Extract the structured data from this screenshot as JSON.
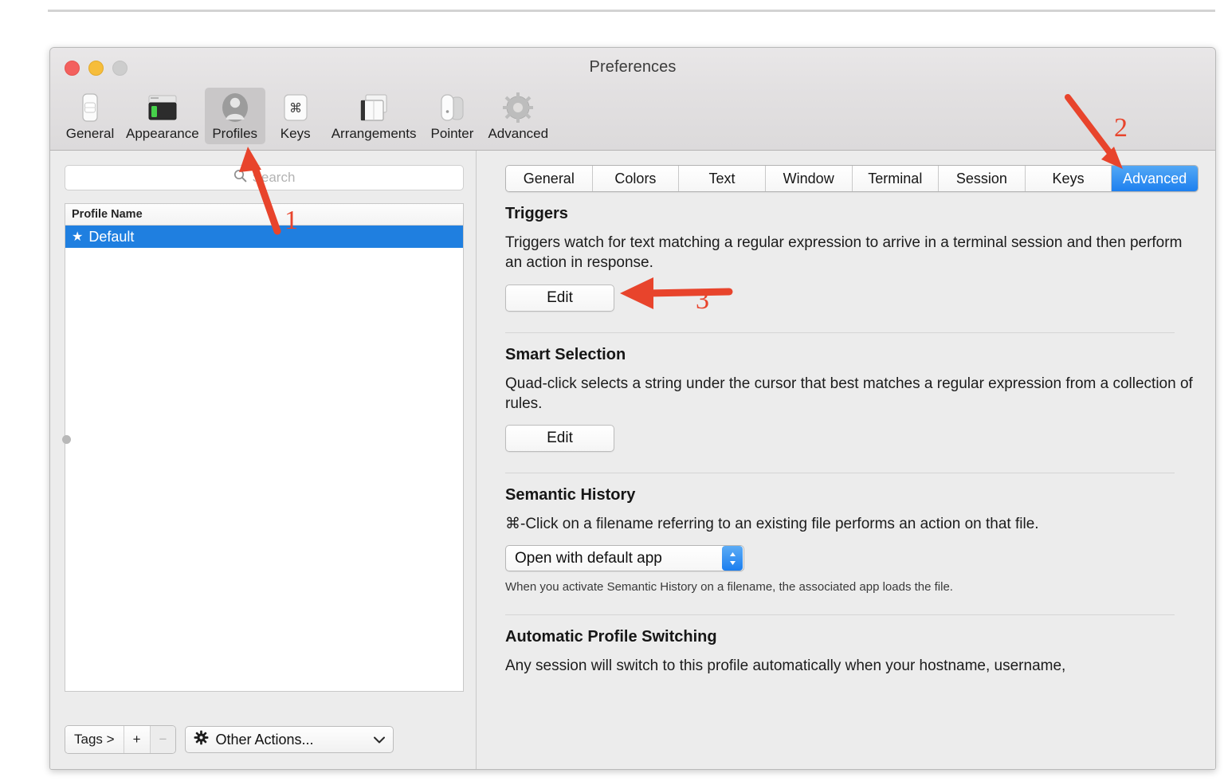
{
  "window": {
    "title": "Preferences",
    "traffic_lights": [
      "close-button",
      "minimize-button",
      "zoom-button"
    ]
  },
  "toolbar": {
    "items": [
      {
        "label": "General",
        "icon": "general-icon",
        "selected": false
      },
      {
        "label": "Appearance",
        "icon": "appearance-icon",
        "selected": false
      },
      {
        "label": "Profiles",
        "icon": "profiles-icon",
        "selected": true
      },
      {
        "label": "Keys",
        "icon": "keys-icon",
        "selected": false
      },
      {
        "label": "Arrangements",
        "icon": "arrangements-icon",
        "selected": false
      },
      {
        "label": "Pointer",
        "icon": "pointer-icon",
        "selected": false
      },
      {
        "label": "Advanced",
        "icon": "advanced-gear-icon",
        "selected": false
      }
    ]
  },
  "sidebar": {
    "search": {
      "placeholder": "Search",
      "value": "",
      "icon": "search-icon"
    },
    "table": {
      "column_header": "Profile Name",
      "rows": [
        {
          "star": "★",
          "name": "Default",
          "selected": true
        }
      ]
    },
    "bottom_bar": {
      "tags_label": "Tags >",
      "add_label": "+",
      "remove_label": "−",
      "other_actions_label": "Other Actions...",
      "other_actions_icon": "gear-icon",
      "chevron": "⌄"
    }
  },
  "tabs": [
    {
      "label": "General",
      "active": false
    },
    {
      "label": "Colors",
      "active": false
    },
    {
      "label": "Text",
      "active": false
    },
    {
      "label": "Window",
      "active": false
    },
    {
      "label": "Terminal",
      "active": false
    },
    {
      "label": "Session",
      "active": false
    },
    {
      "label": "Keys",
      "active": false
    },
    {
      "label": "Advanced",
      "active": true
    }
  ],
  "sections": {
    "triggers": {
      "title": "Triggers",
      "description": "Triggers watch for text matching a regular expression to arrive in a terminal session and then perform an action in response.",
      "button": "Edit"
    },
    "smart_selection": {
      "title": "Smart Selection",
      "description": "Quad-click selects a string under the cursor that best matches a regular expression from a collection of rules.",
      "button": "Edit"
    },
    "semantic_history": {
      "title": "Semantic History",
      "description": "⌘-Click on a filename referring to an existing file performs an action on that file.",
      "popup_value": "Open with default app",
      "note": "When you activate Semantic History on a filename, the associated app loads the file."
    },
    "automatic_profile_switching": {
      "title": "Automatic Profile Switching",
      "description": "Any session will switch to this profile automatically when your hostname, username,"
    }
  },
  "annotations": [
    {
      "number": "1",
      "target": "profiles-toolbar-item"
    },
    {
      "number": "2",
      "target": "advanced-tab"
    },
    {
      "number": "3",
      "target": "triggers-edit-button"
    }
  ],
  "colors": {
    "accent_blue": "#1e80ef",
    "annotation_red": "#e8442c",
    "window_bg": "#ececec",
    "selected_row": "#1f7fe0"
  }
}
